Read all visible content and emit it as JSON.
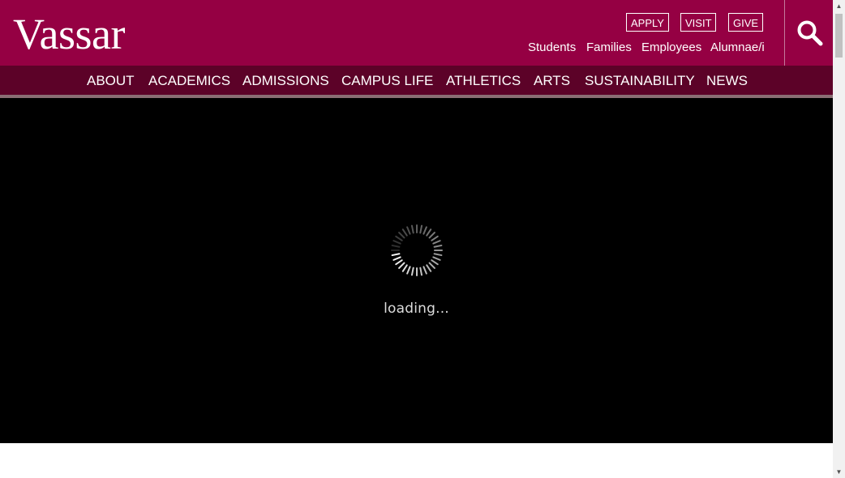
{
  "site": {
    "logo_text": "Vassar"
  },
  "header": {
    "cta": [
      {
        "label": "APPLY"
      },
      {
        "label": "VISIT"
      },
      {
        "label": "GIVE"
      }
    ],
    "audience_links": [
      {
        "label": "Students"
      },
      {
        "label": "Families"
      },
      {
        "label": "Employees"
      },
      {
        "label": "Alumnae/i"
      }
    ],
    "search_icon": "search-icon"
  },
  "nav": {
    "items": [
      {
        "label": "ABOUT"
      },
      {
        "label": "ACADEMICS"
      },
      {
        "label": "ADMISSIONS"
      },
      {
        "label": "CAMPUS LIFE"
      },
      {
        "label": "ATHLETICS"
      },
      {
        "label": "ARTS"
      },
      {
        "label": "SUSTAINABILITY"
      },
      {
        "label": "NEWS"
      }
    ]
  },
  "hero": {
    "loading_text": "loading..."
  },
  "colors": {
    "brand": "#950043",
    "nav_bg": "#5c0228",
    "nav_rule": "#8a6e74",
    "hero_bg": "#000000"
  }
}
